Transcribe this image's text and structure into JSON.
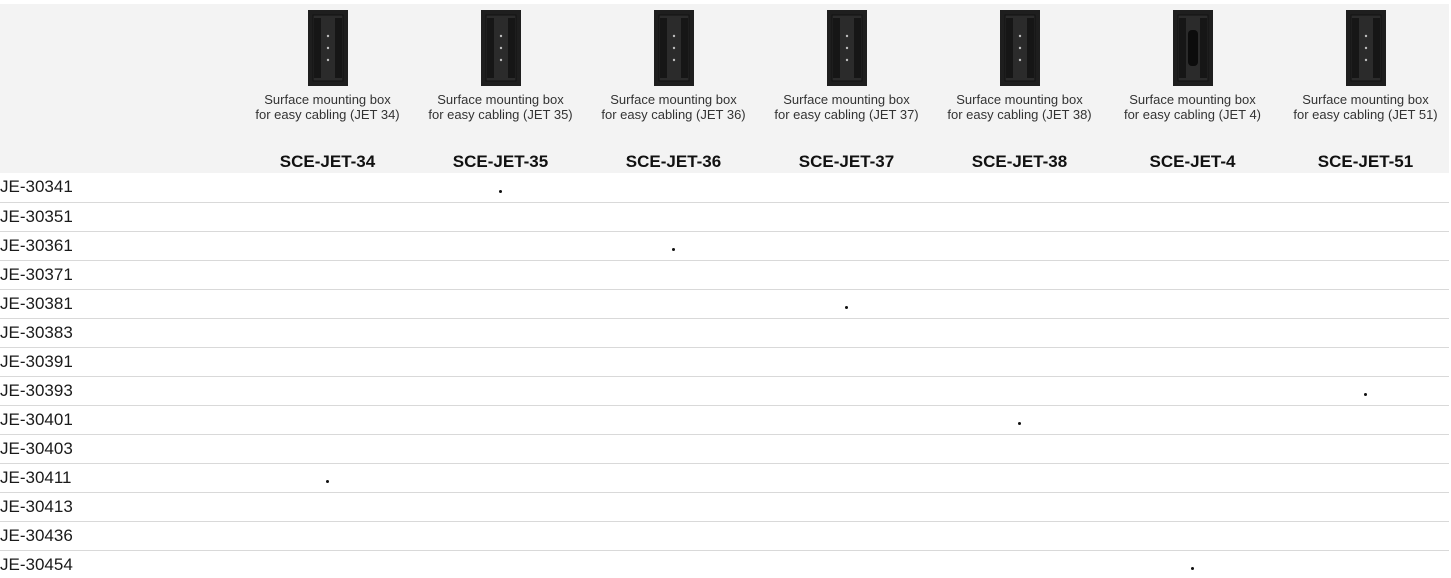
{
  "columns": [
    {
      "desc": "Surface mounting box for easy cabling (JET 34)",
      "code": "SCE-JET-34",
      "icon": "mounting-box-image"
    },
    {
      "desc": "Surface mounting box for easy cabling (JET 35)",
      "code": "SCE-JET-35",
      "icon": "mounting-box-image"
    },
    {
      "desc": "Surface mounting box for easy cabling (JET 36)",
      "code": "SCE-JET-36",
      "icon": "mounting-box-image"
    },
    {
      "desc": "Surface mounting box for easy cabling (JET 37)",
      "code": "SCE-JET-37",
      "icon": "mounting-box-image"
    },
    {
      "desc": "Surface mounting box for easy cabling (JET 38)",
      "code": "SCE-JET-38",
      "icon": "mounting-box-image"
    },
    {
      "desc": "Surface mounting box for easy cabling (JET 4)",
      "code": "SCE-JET-4",
      "icon": "mounting-box-image"
    },
    {
      "desc": "Surface mounting box for easy cabling (JET 51)",
      "code": "SCE-JET-51",
      "icon": "mounting-box-image"
    }
  ],
  "rows": [
    {
      "label": "JE-30341",
      "marks": [
        false,
        true,
        false,
        false,
        false,
        false,
        false
      ]
    },
    {
      "label": "JE-30351",
      "marks": [
        false,
        false,
        false,
        false,
        false,
        false,
        false
      ]
    },
    {
      "label": "JE-30361",
      "marks": [
        false,
        false,
        true,
        false,
        false,
        false,
        false
      ]
    },
    {
      "label": "JE-30371",
      "marks": [
        false,
        false,
        false,
        false,
        false,
        false,
        false
      ]
    },
    {
      "label": "JE-30381",
      "marks": [
        false,
        false,
        false,
        true,
        false,
        false,
        false
      ]
    },
    {
      "label": "JE-30383",
      "marks": [
        false,
        false,
        false,
        false,
        false,
        false,
        false
      ]
    },
    {
      "label": "JE-30391",
      "marks": [
        false,
        false,
        false,
        false,
        false,
        false,
        false
      ]
    },
    {
      "label": "JE-30393",
      "marks": [
        false,
        false,
        false,
        false,
        false,
        false,
        true
      ]
    },
    {
      "label": "JE-30401",
      "marks": [
        false,
        false,
        false,
        false,
        true,
        false,
        false
      ]
    },
    {
      "label": "JE-30403",
      "marks": [
        false,
        false,
        false,
        false,
        false,
        false,
        false
      ]
    },
    {
      "label": "JE-30411",
      "marks": [
        true,
        false,
        false,
        false,
        false,
        false,
        false
      ]
    },
    {
      "label": "JE-30413",
      "marks": [
        false,
        false,
        false,
        false,
        false,
        false,
        false
      ]
    },
    {
      "label": "JE-30436",
      "marks": [
        false,
        false,
        false,
        false,
        false,
        false,
        false
      ]
    },
    {
      "label": "JE-30454",
      "marks": [
        false,
        false,
        false,
        false,
        false,
        true,
        false
      ]
    }
  ],
  "colors": {
    "header_bg": "#f3f3f3",
    "row_divider": "#d9d9d9",
    "dot": "#111111",
    "product_body": "#1e1e1e"
  }
}
